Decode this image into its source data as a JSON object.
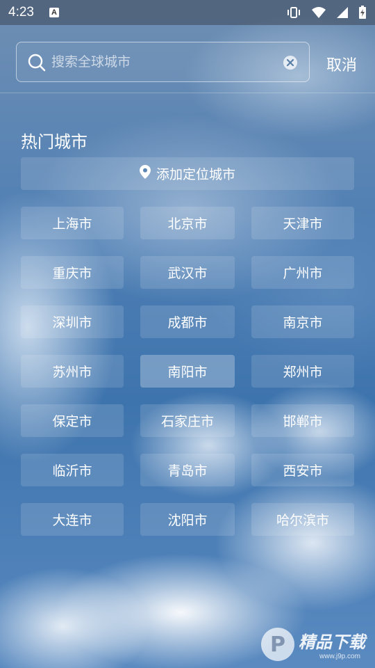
{
  "status_bar": {
    "time": "4:23",
    "notification_icon": "A",
    "icons": [
      "vibrate-icon",
      "wifi-icon",
      "signal-icon",
      "battery-icon"
    ]
  },
  "search": {
    "placeholder": "搜索全球城市",
    "value": "",
    "cancel_label": "取消"
  },
  "hot_cities": {
    "title": "热门城市",
    "add_location_label": "添加定位城市",
    "cities": [
      "上海市",
      "北京市",
      "天津市",
      "重庆市",
      "武汉市",
      "广州市",
      "深圳市",
      "成都市",
      "南京市",
      "苏州市",
      "南阳市",
      "郑州市",
      "保定市",
      "石家庄市",
      "邯郸市",
      "临沂市",
      "青岛市",
      "西安市",
      "大连市",
      "沈阳市",
      "哈尔滨市"
    ],
    "highlighted": "南阳市"
  },
  "watermark": {
    "logo_letter": "P",
    "main_text": "精品下载",
    "sub_text": "www.j9p.com"
  }
}
